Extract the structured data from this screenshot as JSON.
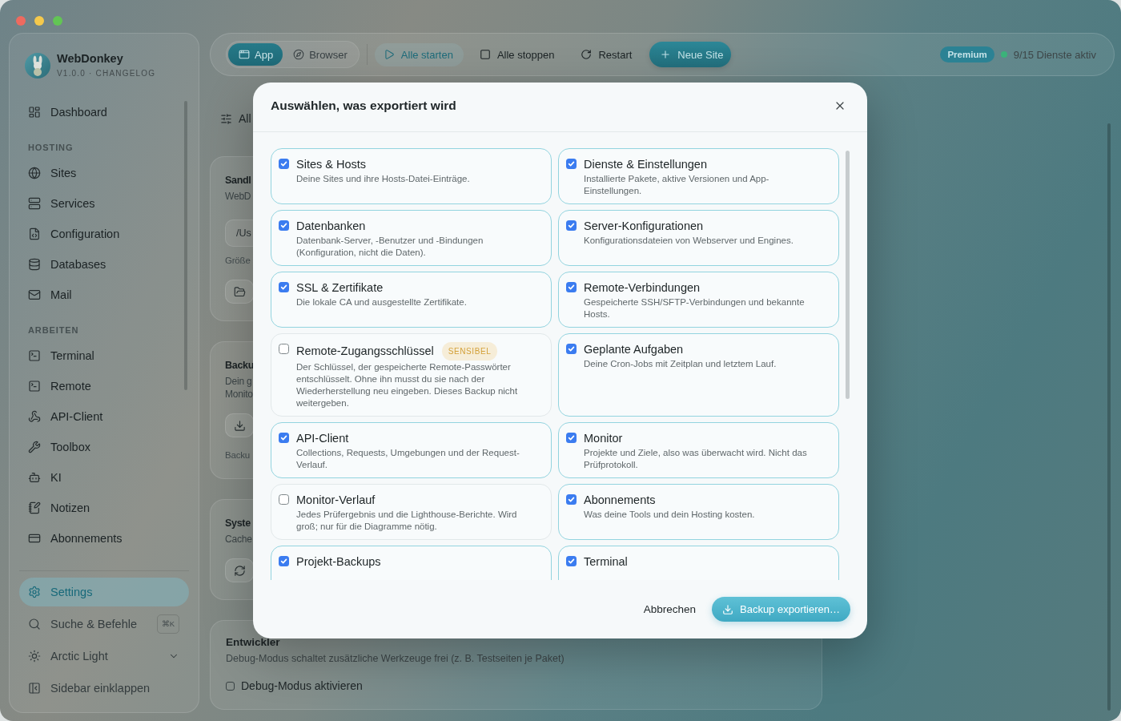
{
  "sidebar": {
    "app_name": "WebDonkey",
    "version": "V1.0.0 · CHANGELOG",
    "sections": [
      {
        "items": [
          {
            "label": "Dashboard",
            "selected": false
          }
        ]
      },
      {
        "heading": "HOSTING",
        "items": [
          {
            "label": "Sites",
            "selected": false
          },
          {
            "label": "Services",
            "selected": false
          },
          {
            "label": "Configuration",
            "selected": false
          },
          {
            "label": "Databases",
            "selected": false
          },
          {
            "label": "Mail",
            "selected": false
          }
        ]
      },
      {
        "heading": "ARBEITEN",
        "items": [
          {
            "label": "Terminal",
            "selected": false
          },
          {
            "label": "Remote",
            "selected": false
          },
          {
            "label": "API-Client",
            "selected": false
          },
          {
            "label": "Toolbox",
            "selected": false
          },
          {
            "label": "KI",
            "selected": false
          },
          {
            "label": "Notizen",
            "selected": false
          },
          {
            "label": "Abonnements",
            "selected": false
          }
        ]
      }
    ],
    "footer": [
      {
        "kind": "nav",
        "label": "Settings",
        "selected": true
      },
      {
        "kind": "search",
        "label": "Suche & Befehle",
        "shortcut": "⌘K"
      },
      {
        "kind": "theme",
        "label": "Arctic Light"
      },
      {
        "kind": "collapse",
        "label": "Sidebar einklappen"
      }
    ]
  },
  "toolbar": {
    "view_tabs": [
      {
        "label": "App",
        "selected": true
      },
      {
        "label": "Browser",
        "selected": false
      }
    ],
    "actions": [
      {
        "kind": "start",
        "label": "Alle starten"
      },
      {
        "kind": "stop",
        "label": "Alle stoppen"
      },
      {
        "kind": "restart",
        "label": "Restart"
      },
      {
        "kind": "primary",
        "label": "Neue Site"
      }
    ],
    "plan_badge": "Premium",
    "status": "9/15 Dienste aktiv"
  },
  "content": {
    "filter": "All",
    "cards": [
      {
        "title": "Sandl",
        "parts": [
          {
            "kind": "text",
            "text": "WebD"
          },
          {
            "kind": "field",
            "value": "/Us"
          },
          {
            "kind": "note",
            "text": "Größe"
          },
          {
            "kind": "icon_button"
          }
        ]
      },
      {
        "title": "Backu",
        "parts": [
          {
            "kind": "text",
            "text": "Dein g"
          },
          {
            "kind": "text",
            "text": "Monito"
          },
          {
            "kind": "icon_button"
          },
          {
            "kind": "note",
            "text": "Backu"
          }
        ]
      },
      {
        "title": "Syste",
        "parts": [
          {
            "kind": "text",
            "text": "Cache"
          },
          {
            "kind": "icon_button"
          }
        ]
      }
    ],
    "developer": {
      "title": "Entwickler",
      "description": "Debug-Modus schaltet zusätzliche Werkzeuge frei (z. B. Testseiten je Paket)",
      "option": {
        "label": "Debug-Modus aktivieren",
        "checked": false
      }
    }
  },
  "dialog": {
    "title": "Auswählen, was exportiert wird",
    "options": [
      {
        "title": "Sites & Hosts",
        "description": "Deine Sites und ihre Hosts-Datei-Einträge.",
        "checked": true
      },
      {
        "title": "Dienste & Einstellungen",
        "description": "Installierte Pakete, aktive Versionen und App-Einstellungen.",
        "checked": true
      },
      {
        "title": "Datenbanken",
        "description": "Datenbank-Server, -Benutzer und -Bindungen (Konfiguration, nicht die Daten).",
        "checked": true
      },
      {
        "title": "Server-Konfigurationen",
        "description": "Konfigurationsdateien von Webserver und Engines.",
        "checked": true
      },
      {
        "title": "SSL & Zertifikate",
        "description": "Die lokale CA und ausgestellte Zertifikate.",
        "checked": true
      },
      {
        "title": "Remote-Verbindungen",
        "description": "Gespeicherte SSH/SFTP-Verbindungen und bekannte Hosts.",
        "checked": true
      },
      {
        "title": "Remote-Zugangsschlüssel",
        "badge": "SENSIBEL",
        "description": "Der Schlüssel, der gespeicherte Remote-Passwörter entschlüsselt. Ohne ihn musst du sie nach der Wiederherstellung neu eingeben. Dieses Backup nicht weitergeben.",
        "checked": false
      },
      {
        "title": "Geplante Aufgaben",
        "description": "Deine Cron-Jobs mit Zeitplan und letztem Lauf.",
        "checked": true
      },
      {
        "title": "API-Client",
        "description": "Collections, Requests, Umgebungen und der Request-Verlauf.",
        "checked": true
      },
      {
        "title": "Monitor",
        "description": "Projekte und Ziele, also was überwacht wird. Nicht das Prüfprotokoll.",
        "checked": true
      },
      {
        "title": "Monitor-Verlauf",
        "description": "Jedes Prüfergebnis und die Lighthouse-Berichte. Wird groß; nur für die Diagramme nötig.",
        "checked": false
      },
      {
        "title": "Abonnements",
        "description": "Was deine Tools und dein Hosting kosten.",
        "checked": true
      },
      {
        "title": "Projekt-Backups",
        "checked": true
      },
      {
        "title": "Terminal",
        "checked": true
      }
    ],
    "buttons": [
      {
        "kind": "secondary",
        "label": "Abbrechen"
      },
      {
        "kind": "primary",
        "label": "Backup exportieren…"
      }
    ]
  }
}
